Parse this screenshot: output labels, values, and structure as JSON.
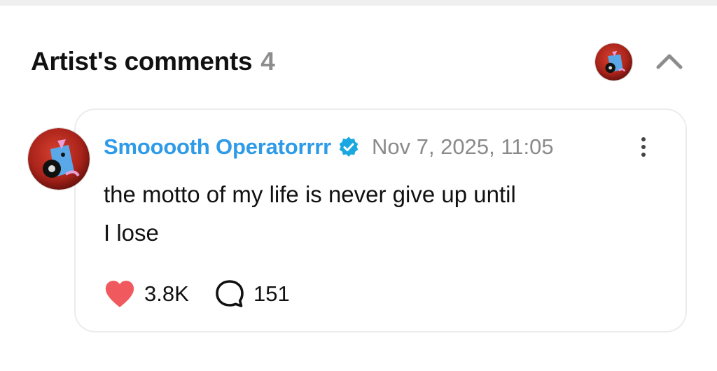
{
  "header": {
    "title": "Artist's comments",
    "count": "4"
  },
  "comment": {
    "author": "Smooooth Operatorrrr",
    "timestamp": "Nov 7, 2025, 11:05",
    "text_line1": "the motto of my life is never give up until",
    "text_line2": "I lose",
    "likes": "3.8K",
    "replies": "151"
  },
  "icons": {
    "header_avatar": "user-avatar-icon",
    "collapse": "chevron-up-icon",
    "verified": "verified-badge-icon",
    "more": "more-vertical-icon",
    "like": "heart-icon",
    "reply": "speech-bubble-icon"
  },
  "colors": {
    "author": "#2e9be8",
    "verified": "#1ba8e0",
    "heart": "#f05a5f",
    "muted": "#8a8a8a",
    "avatar_red": "#b3261e"
  }
}
